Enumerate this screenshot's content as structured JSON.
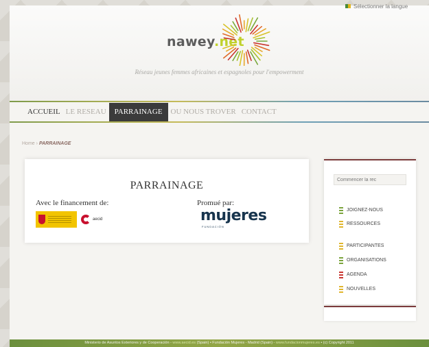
{
  "header": {
    "logo_name": "nawey",
    "logo_tld": ".net",
    "tagline": "Réseau jeunes femmes africaines et espagnoles pour l'empowerment",
    "lang_select": "Sélectionner la langue"
  },
  "nav": {
    "items": [
      {
        "label": "ACCUEIL"
      },
      {
        "label": "LE RESEAU"
      },
      {
        "label": "PARRAINAGE"
      },
      {
        "label": "OU NOUS TROVER"
      },
      {
        "label": "CONTACT"
      }
    ],
    "active_index": 2
  },
  "breadcrumb": {
    "home": "Home",
    "separator": "›",
    "current": "PARRAINAGE"
  },
  "content": {
    "title": "PARRAINAGE",
    "funding_label": "Avec le financement de:",
    "promoted_label": "Promué par:",
    "aecid_text": "aecid",
    "mujeres_logo": "mujeres",
    "mujeres_sub": "FUNDACIÓN"
  },
  "sidebar": {
    "search_placeholder": "Commencer la rec",
    "items": [
      {
        "label": "JOIGNEZ-NOUS",
        "icon": "green-bars-icon"
      },
      {
        "label": "RESSOURCES",
        "icon": "yellow-bars-icon"
      },
      {
        "label": "PARTICIPANTES",
        "icon": "yellow-bars-icon"
      },
      {
        "label": "ORGANISATIONS",
        "icon": "green-bars-icon"
      },
      {
        "label": "AGENDA",
        "icon": "red-bars-icon"
      },
      {
        "label": "NOUVELLES",
        "icon": "yellow-bars-icon"
      }
    ]
  },
  "footer": {
    "part1": "Ministerio de Asuntos Exteriores y de Cooperación - ",
    "link1": "www.aecid.es",
    "part2": " (Spain)  •  Fundación Mujeres - Madrid (Spain) - ",
    "link2": "www.fundacionmujeres.es",
    "part3": "  •  (c) Copyright 2011"
  },
  "colors": {
    "nav_active_bg": "#3b3b3b",
    "accent_green": "#c0d12c",
    "footer_green": "#7b9a41",
    "sidebar_border": "#7b3b3b"
  }
}
